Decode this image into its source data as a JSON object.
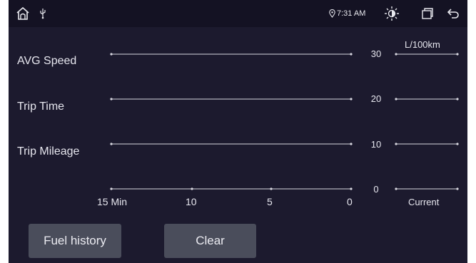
{
  "status_bar": {
    "time": "7:31 AM"
  },
  "rows": [
    {
      "label": "AVG Speed"
    },
    {
      "label": "Trip Time"
    },
    {
      "label": "Trip Mileage"
    }
  ],
  "fuel_axis": {
    "unit": "L/100km",
    "values": [
      "30",
      "20",
      "10",
      "0"
    ]
  },
  "time_axis": {
    "labels": [
      "15 Min",
      "10",
      "5",
      "0"
    ],
    "current_label": "Current"
  },
  "buttons": {
    "fuel_history": "Fuel history",
    "clear": "Clear"
  },
  "colors": {
    "background": "#1c1a2e",
    "status_bar": "#141223",
    "button": "#4a4d5b",
    "text": "#e6e6ee"
  }
}
